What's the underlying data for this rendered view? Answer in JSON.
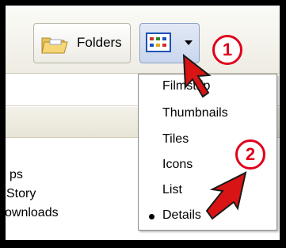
{
  "toolbar": {
    "folders_label": "Folders",
    "views_button_icon": "views-grid-icon"
  },
  "file_list": {
    "items": [
      "ps",
      "Story",
      "ownloads"
    ]
  },
  "views_menu": {
    "items": [
      "Filmstrip",
      "Thumbnails",
      "Tiles",
      "Icons",
      "List",
      "Details"
    ],
    "selected": "Details"
  },
  "annotations": {
    "step1": "1",
    "step2": "2",
    "color": "#e0001b"
  }
}
